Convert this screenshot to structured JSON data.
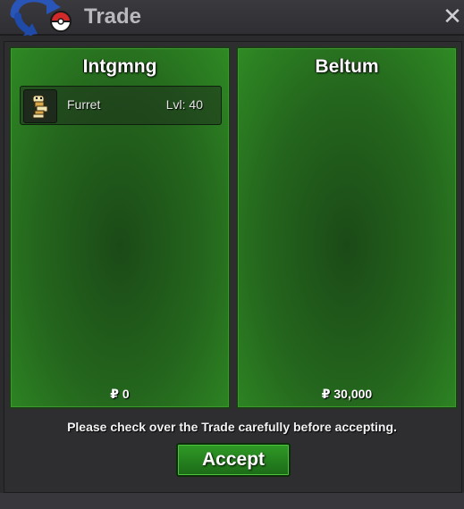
{
  "window": {
    "title": "Trade",
    "close_symbol": "✕"
  },
  "icons": {
    "app": "trade-arrows-pokeball-icon",
    "close": "close-icon",
    "pokemon_sprite": "furret-sprite-icon"
  },
  "left_panel": {
    "player_name": "Intgmng",
    "pokemon": [
      {
        "name": "Furret",
        "level": "Lvl: 40"
      }
    ],
    "money": "₽ 0"
  },
  "right_panel": {
    "player_name": "Beltum",
    "pokemon": [],
    "money": "₽ 30,000"
  },
  "footer": {
    "notice": "Please check over the Trade carefully before accepting.",
    "accept_label": "Accept"
  },
  "colors": {
    "panel_green": "#24661d",
    "button_green": "#2f9a26",
    "window_bg": "#2b2b2e"
  }
}
